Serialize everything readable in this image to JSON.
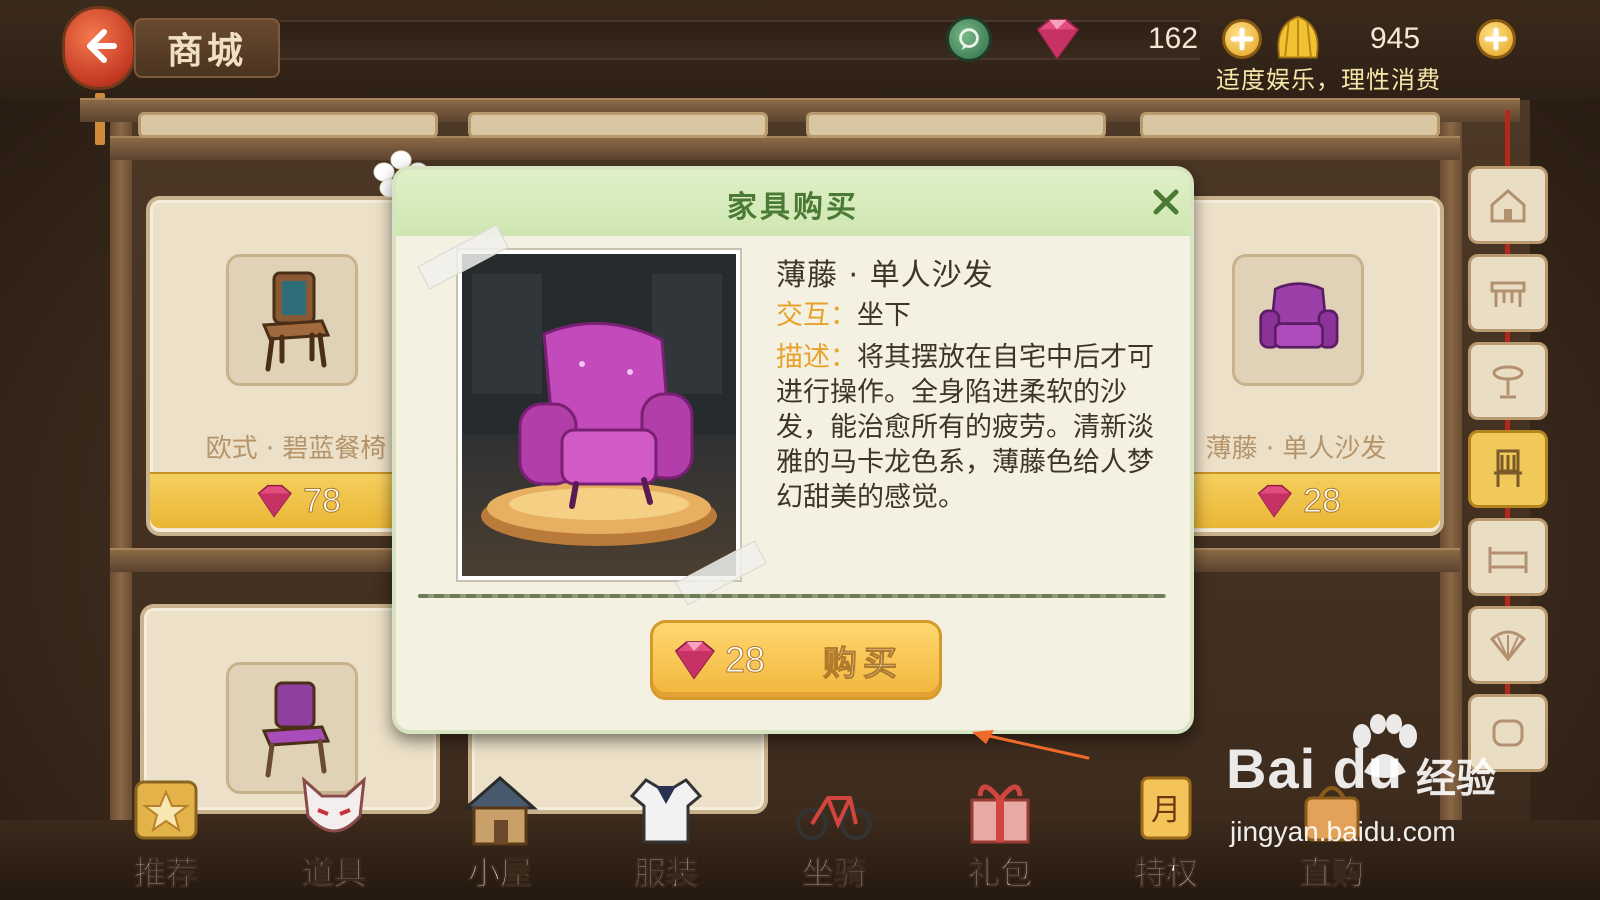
{
  "header": {
    "title": "商城",
    "gems": "162",
    "coins": "945",
    "notice": "适度娱乐，理性消费"
  },
  "shelf_items": [
    {
      "name": "欧式 · 碧蓝餐椅",
      "price": "78",
      "icon": "chair-icon"
    },
    {
      "name": "薄藤 · 单人沙发",
      "price": "28",
      "icon": "armchair-icon"
    }
  ],
  "category_tabs": [
    {
      "icon": "house-icon",
      "active": false
    },
    {
      "icon": "table-icon",
      "active": false
    },
    {
      "icon": "lamp-icon",
      "active": false
    },
    {
      "icon": "chair-icon",
      "active": true
    },
    {
      "icon": "bed-icon",
      "active": false
    },
    {
      "icon": "fan-icon",
      "active": false
    },
    {
      "icon": "cushion-icon",
      "active": false
    }
  ],
  "bottom_nav": [
    {
      "label": "推荐",
      "icon": "star-icon"
    },
    {
      "label": "道具",
      "icon": "fox-mask-icon"
    },
    {
      "label": "小屋",
      "icon": "cottage-icon"
    },
    {
      "label": "服装",
      "icon": "uniform-icon"
    },
    {
      "label": "坐骑",
      "icon": "bicycle-icon"
    },
    {
      "label": "礼包",
      "icon": "gift-icon"
    },
    {
      "label": "特权",
      "icon": "month-card-icon"
    },
    {
      "label": "直购",
      "icon": "bag-icon"
    }
  ],
  "dialog": {
    "title": "家具购买",
    "product_name": "薄藤 · 单人沙发",
    "interaction_key": "交互：",
    "interaction_value": "坐下",
    "description_key": "描述：",
    "description_value": "将其摆放在自宅中后才可进行操作。全身陷进柔软的沙发，能治愈所有的疲劳。清新淡雅的马卡龙色系，薄藤色给人梦幻甜美的感觉。",
    "price": "28",
    "buy_label": "购买"
  },
  "watermark": {
    "logo": "Bai  du",
    "cn": "经验",
    "url": "jingyan.baidu.com"
  },
  "colors": {
    "accent_green": "#4b7a34",
    "gold": "#f2b63c",
    "gem_pink": "#e0487a"
  }
}
